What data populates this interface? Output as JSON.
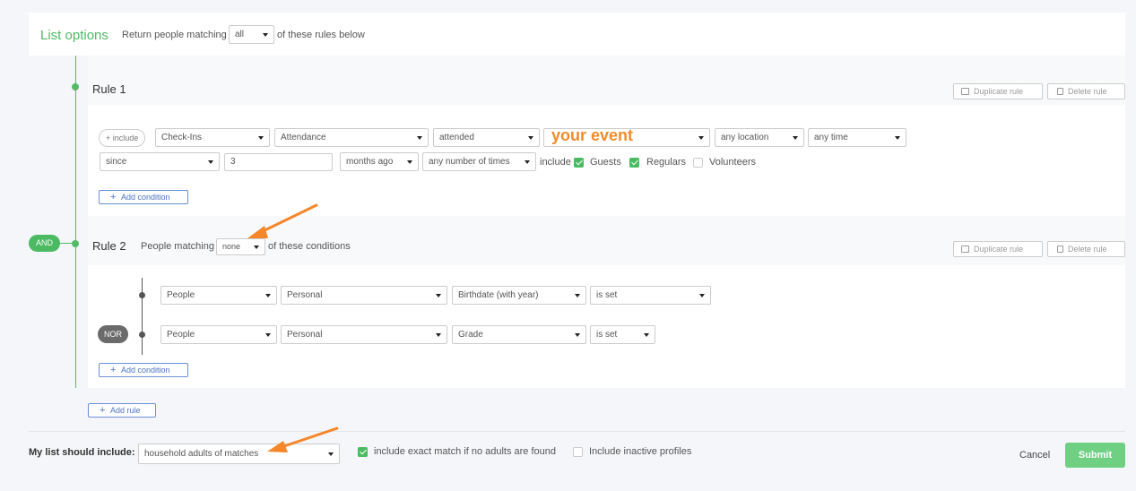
{
  "list_options": {
    "title": "List options",
    "prefix": "Return people matching",
    "match_value": "all",
    "suffix": "of these rules below"
  },
  "rule1": {
    "title": "Rule 1",
    "duplicate_label": "Duplicate rule",
    "delete_label": "Delete rule",
    "include_pill": "+ include",
    "row1": [
      "Check-Ins",
      "Attendance",
      "attended",
      "",
      "any location",
      "any time"
    ],
    "event_placeholder": "your event",
    "row2": {
      "since": "since",
      "number": "3",
      "unit": "months ago",
      "frequency": "any number of times",
      "include_label": "include",
      "guests": "Guests",
      "regulars": "Regulars",
      "volunteers": "Volunteers"
    },
    "add_condition": "Add condition"
  },
  "and_label": "AND",
  "rule2": {
    "title": "Rule 2",
    "prefix": "People matching",
    "match_value": "none",
    "suffix": "of these conditions",
    "duplicate_label": "Duplicate rule",
    "delete_label": "Delete rule",
    "cond1": [
      "People",
      "Personal",
      "Birthdate (with year)",
      "is set"
    ],
    "nor_label": "NOR",
    "cond2": [
      "People",
      "Personal",
      "Grade",
      "is set"
    ],
    "add_condition": "Add condition"
  },
  "add_rule": "Add rule",
  "footer": {
    "label": "My list should include:",
    "include_value": "household adults of matches",
    "exact_match": "include exact match if no adults are found",
    "inactive": "Include inactive profiles",
    "cancel": "Cancel",
    "submit": "Submit"
  },
  "colors": {
    "accent_green": "#4cba62",
    "annotation_orange": "#f08c2a",
    "link_blue": "#4a72c4"
  }
}
